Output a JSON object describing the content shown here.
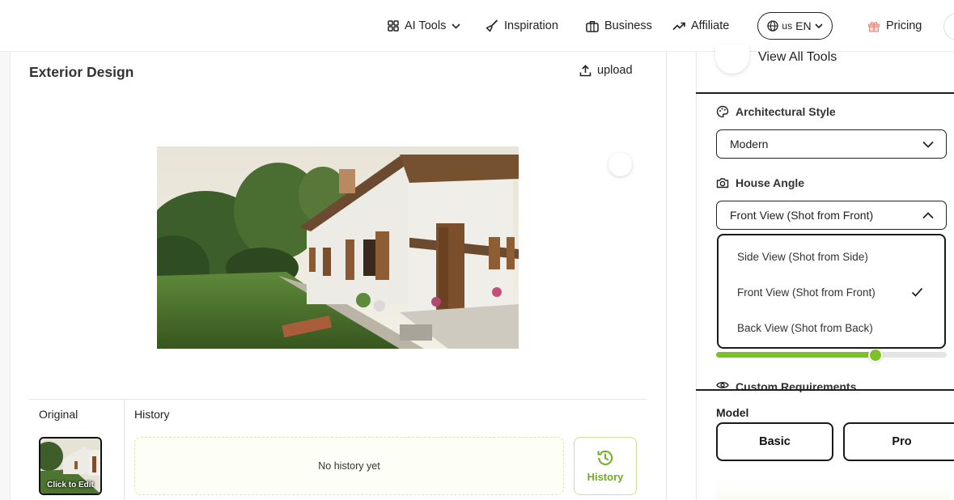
{
  "nav": {
    "ai_tools": "AI Tools",
    "inspiration": "Inspiration",
    "business": "Business",
    "affiliate": "Affiliate",
    "lang_region": "us",
    "lang_code": "EN",
    "pricing": "Pricing"
  },
  "main": {
    "title": "Exterior Design",
    "upload_label": "upload",
    "original_label": "Original",
    "history_label": "History",
    "thumb_caption": "Click to Edit",
    "empty_history_text": "No history yet",
    "history_button_label": "History"
  },
  "sidebar": {
    "view_all_tools": "View All Tools",
    "arch_style_label": "Architectural Style",
    "arch_style_value": "Modern",
    "house_angle_label": "House Angle",
    "house_angle_value": "Front View (Shot from Front)",
    "angle_options": [
      "Side View (Shot from Side)",
      "Front View (Shot from Front)",
      "Back View (Shot from Back)"
    ],
    "selected_option_index": 1,
    "slider_value_fraction": 0.69,
    "custom_requirements_label": "Custom Requirements",
    "model_label": "Model",
    "model_options": [
      "Basic",
      "Pro"
    ]
  },
  "colors": {
    "accent_green": "#7cc128",
    "history_green": "#6fae1d",
    "border_dark": "#1a1a1a"
  }
}
